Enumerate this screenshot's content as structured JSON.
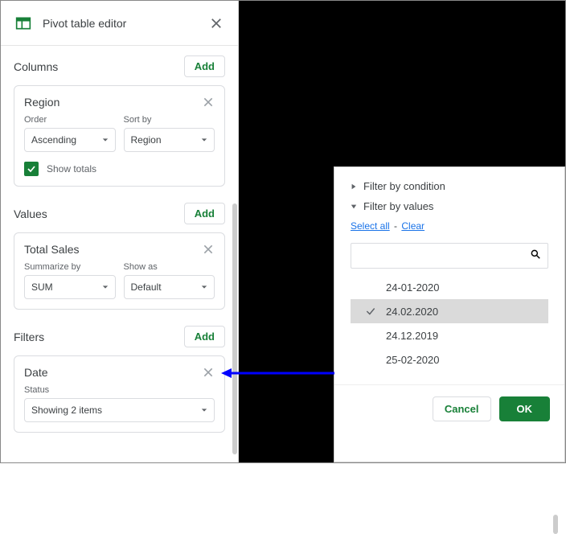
{
  "editor": {
    "title": "Pivot table editor",
    "sections": {
      "columns": {
        "label": "Columns",
        "add": "Add",
        "card": {
          "title": "Region",
          "order_label": "Order",
          "order_value": "Ascending",
          "sort_label": "Sort by",
          "sort_value": "Region",
          "show_totals": "Show totals"
        }
      },
      "values": {
        "label": "Values",
        "add": "Add",
        "card": {
          "title": "Total Sales",
          "summarize_label": "Summarize by",
          "summarize_value": "SUM",
          "showas_label": "Show as",
          "showas_value": "Default"
        }
      },
      "filters": {
        "label": "Filters",
        "add": "Add",
        "card": {
          "title": "Date",
          "status_label": "Status",
          "status_value": "Showing 2 items"
        }
      }
    }
  },
  "popup": {
    "condition_label": "Filter by condition",
    "values_label": "Filter by values",
    "select_all": "Select all",
    "clear": "Clear",
    "items": [
      {
        "label": "24-01-2020",
        "checked": false
      },
      {
        "label": "24.02.2020",
        "checked": true
      },
      {
        "label": "24.12.2019",
        "checked": false
      },
      {
        "label": "25-02-2020",
        "checked": false
      }
    ],
    "cancel": "Cancel",
    "ok": "OK"
  }
}
